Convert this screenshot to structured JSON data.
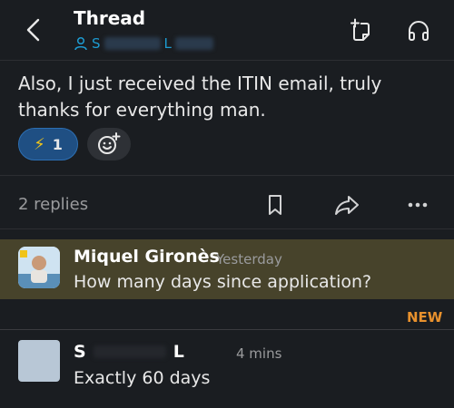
{
  "header": {
    "title": "Thread",
    "channel_first": "S",
    "channel_last": "L",
    "back_icon": "chevron-left-icon",
    "new_note_icon": "new-note-icon",
    "huddle_icon": "headphones-icon"
  },
  "message": {
    "text": "Also, I just received the ITIN email, truly thanks for everything man.",
    "reaction_emoji": "⚡",
    "reaction_count": "1",
    "add_reaction_icon": "add-reaction-icon"
  },
  "actions": {
    "replies": "2 replies",
    "bookmark_icon": "bookmark-icon",
    "share_icon": "share-icon",
    "more_icon": "more-icon"
  },
  "replies": [
    {
      "name": "Miquel Gironès",
      "time": "Yesterday",
      "text": "How many days since application?"
    },
    {
      "name_first": "S",
      "name_last": "L",
      "time": "4 mins",
      "text": "Exactly 60 days"
    }
  ],
  "new_label": "NEW",
  "colors": {
    "background": "#1a1d21",
    "highlight": "#47432b",
    "accent": "#1d9bd1",
    "new_badge": "#e8912d",
    "reaction_bg": "#1f4f83"
  }
}
